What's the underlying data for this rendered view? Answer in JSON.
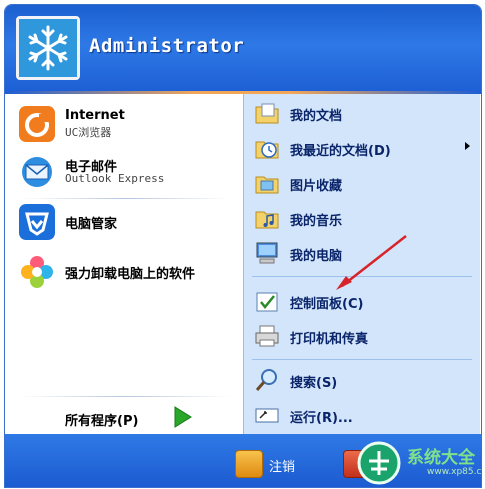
{
  "header": {
    "username": "Administrator"
  },
  "left_panel": {
    "pinned": [
      {
        "title": "Internet",
        "subtitle": "UC浏览器",
        "icon": "uc-browser-icon"
      },
      {
        "title": "电子邮件",
        "subtitle": "Outlook Express",
        "icon": "email-icon"
      }
    ],
    "recent": [
      {
        "title": "电脑管家",
        "icon": "pc-manager-icon"
      },
      {
        "title": "强力卸载电脑上的软件",
        "icon": "uninstaller-icon"
      }
    ],
    "all_programs": "所有程序(P)"
  },
  "right_panel": {
    "items": [
      {
        "label": "我的文档",
        "icon": "my-documents-icon"
      },
      {
        "label": "我最近的文档(D)",
        "icon": "recent-documents-icon",
        "submenu": true
      },
      {
        "label": "图片收藏",
        "icon": "my-pictures-icon"
      },
      {
        "label": "我的音乐",
        "icon": "my-music-icon"
      },
      {
        "label": "我的电脑",
        "icon": "my-computer-icon"
      },
      {
        "label": "控制面板(C)",
        "icon": "control-panel-icon"
      },
      {
        "label": "打印机和传真",
        "icon": "printer-icon"
      },
      {
        "label": "搜索(S)",
        "icon": "search-icon"
      },
      {
        "label": "运行(R)...",
        "icon": "run-icon"
      }
    ]
  },
  "footer": {
    "logoff_label": "注销"
  },
  "watermark": {
    "text": "系统大全",
    "url": "www.xp85.com"
  },
  "colors": {
    "accent": "#1d5ed4",
    "right_panel": "#d3e5fa",
    "highlight_ring": "#d6242a"
  }
}
